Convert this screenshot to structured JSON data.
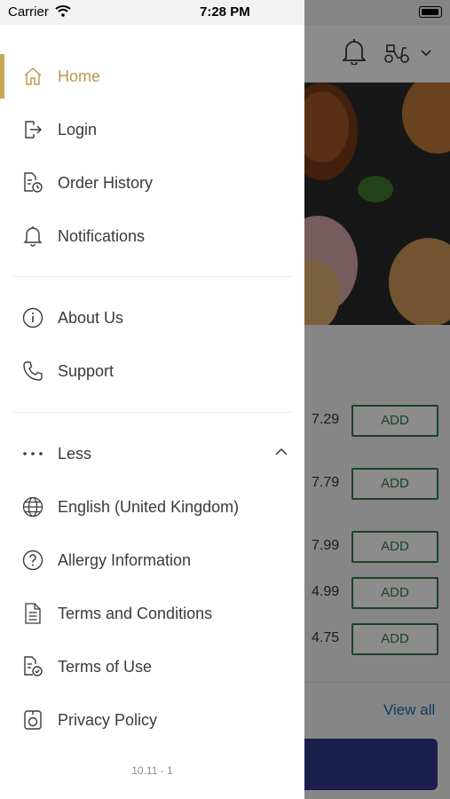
{
  "status_bar": {
    "carrier": "Carrier",
    "time": "7:28 PM"
  },
  "menu": {
    "items_top": [
      {
        "label": "Home",
        "icon": "home-icon",
        "active": true
      },
      {
        "label": "Login",
        "icon": "login-icon"
      },
      {
        "label": "Order History",
        "icon": "order-history-icon"
      },
      {
        "label": "Notifications",
        "icon": "bell-icon"
      }
    ],
    "items_mid": [
      {
        "label": "About Us",
        "icon": "info-icon"
      },
      {
        "label": "Support",
        "icon": "phone-icon"
      }
    ],
    "less": {
      "label": "Less",
      "icon": "more-dots-icon"
    },
    "items_bottom": [
      {
        "label": "English (United Kingdom)",
        "icon": "globe-icon"
      },
      {
        "label": "Allergy Information",
        "icon": "question-icon"
      },
      {
        "label": "Terms and Conditions",
        "icon": "document-icon"
      },
      {
        "label": "Terms of Use",
        "icon": "document-check-icon"
      },
      {
        "label": "Privacy Policy",
        "icon": "privacy-icon"
      }
    ],
    "version": "10.11 - 1"
  },
  "background": {
    "prices": [
      "7.29",
      "7.79",
      "7.99",
      "4.99",
      "4.75"
    ],
    "add_label": "ADD",
    "view_all": "View all"
  },
  "colors": {
    "accent": "#c7a752",
    "add_green": "#2f7a48",
    "link_blue": "#1a6fb0",
    "checkout": "#2d3a8c"
  }
}
